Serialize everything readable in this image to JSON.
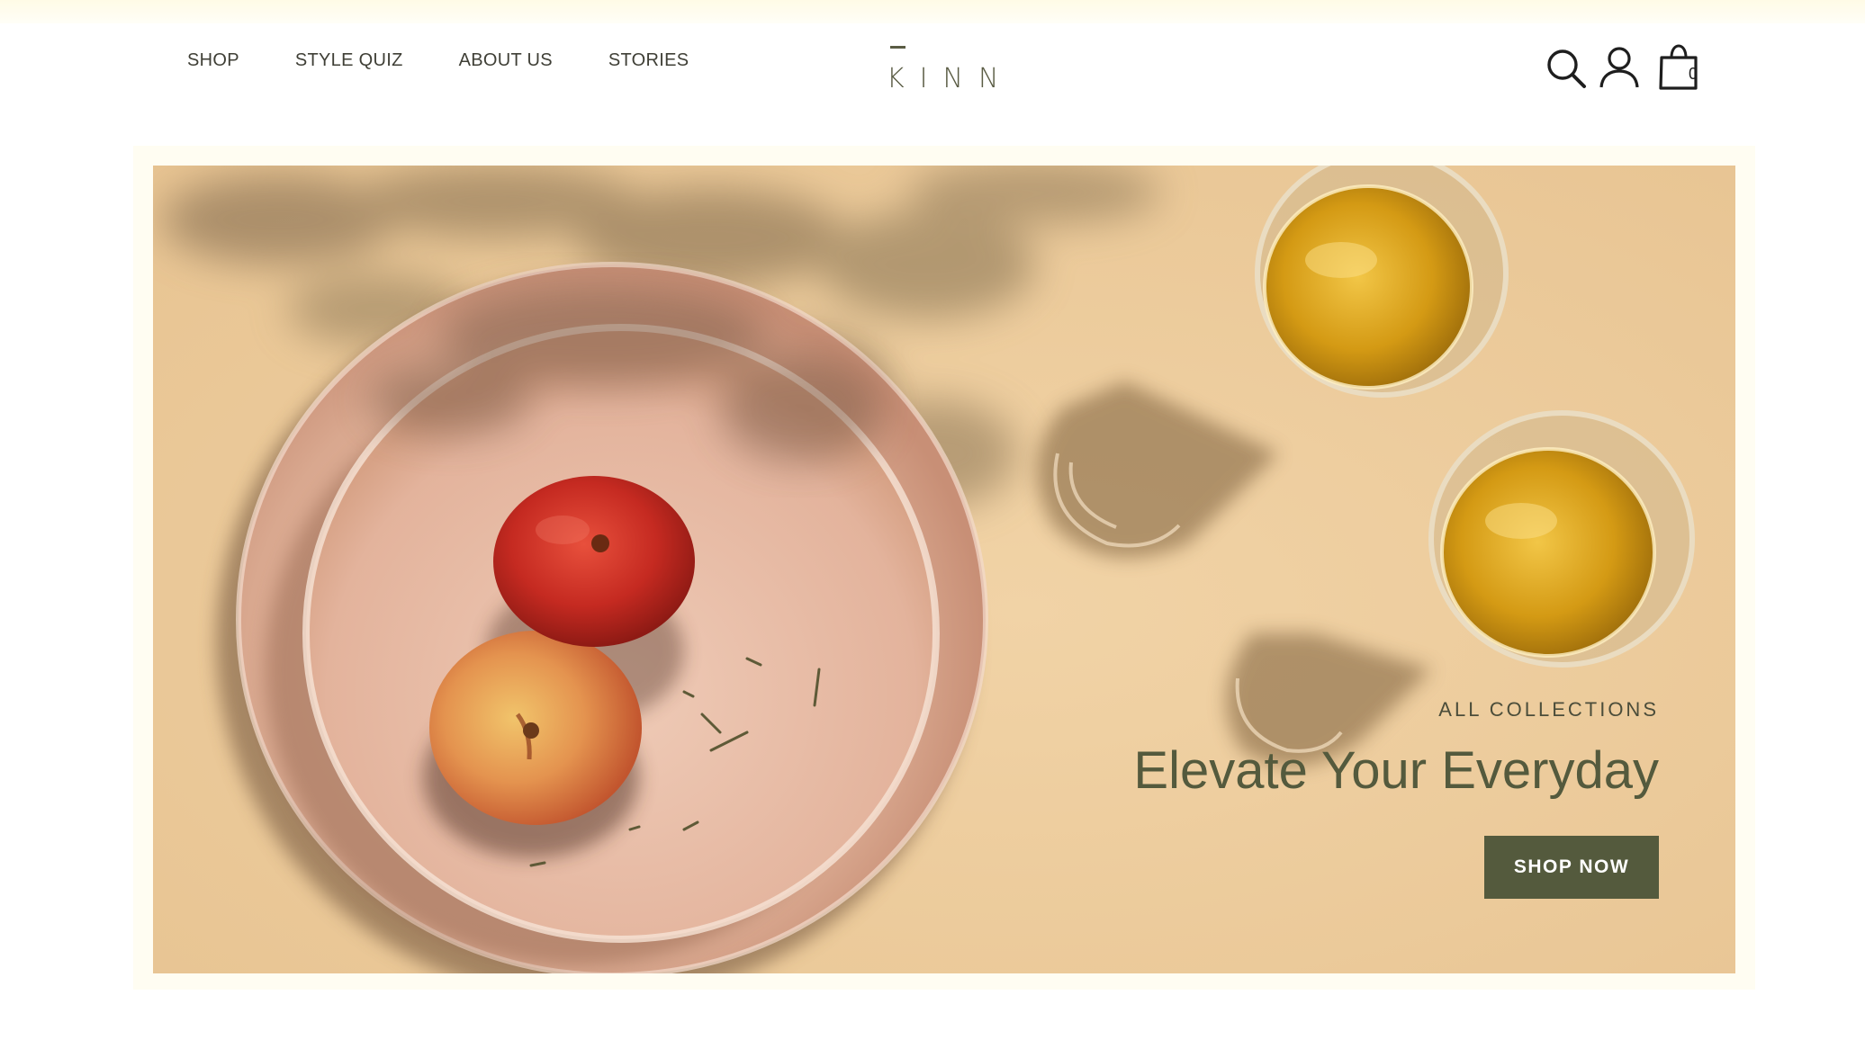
{
  "nav": {
    "items": [
      {
        "label": "SHOP"
      },
      {
        "label": "STYLE QUIZ"
      },
      {
        "label": "ABOUT US"
      },
      {
        "label": "STORIES"
      }
    ]
  },
  "brand": {
    "logo_text": "KINN"
  },
  "header_icons": {
    "search": "search-icon",
    "account": "user-icon",
    "cart": "shopping-bag-icon",
    "cart_count": "0"
  },
  "hero": {
    "eyebrow": "ALL COLLECTIONS",
    "title": "Elevate Your Everyday",
    "cta_label": "SHOP NOW"
  },
  "colors": {
    "accent": "#545a3d",
    "hero_background": "#eccfa3",
    "frame": "#fffdf2",
    "top_strip": "#fffbe6"
  }
}
